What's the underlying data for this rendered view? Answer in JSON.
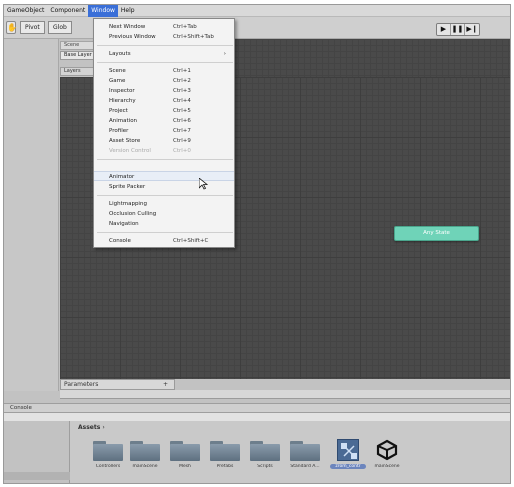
{
  "menubar": {
    "items": [
      {
        "label": "GameObject"
      },
      {
        "label": "Component"
      },
      {
        "label": "Window"
      },
      {
        "label": "Help"
      }
    ]
  },
  "toolbar": {
    "hand_icon": "✋",
    "pivot_label": "Pivot",
    "global_label": "Glob",
    "play_icons": [
      "▶",
      "❚❚",
      "▶❙"
    ]
  },
  "scene_tab": "Scene",
  "left_panel": {
    "base_layer": "Base Layer",
    "layers_label": "Layers",
    "parameters_label": "Parameters",
    "parameters_add": "+"
  },
  "canvas": {
    "any_state_label": "Any State",
    "any_state_color": "#6fd3b8"
  },
  "window_menu": {
    "items": [
      {
        "label": "Next Window",
        "shortcut": "Ctrl+Tab"
      },
      {
        "label": "Previous Window",
        "shortcut": "Ctrl+Shift+Tab"
      },
      {
        "label": "Layouts",
        "shortcut": "",
        "submenu": "›"
      },
      {
        "label": "Scene",
        "shortcut": "Ctrl+1"
      },
      {
        "label": "Game",
        "shortcut": "Ctrl+2"
      },
      {
        "label": "Inspector",
        "shortcut": "Ctrl+3"
      },
      {
        "label": "Hierarchy",
        "shortcut": "Ctrl+4"
      },
      {
        "label": "Project",
        "shortcut": "Ctrl+5"
      },
      {
        "label": "Animation",
        "shortcut": "Ctrl+6"
      },
      {
        "label": "Profiler",
        "shortcut": "Ctrl+7"
      },
      {
        "label": "Asset Store",
        "shortcut": "Ctrl+9"
      },
      {
        "label": "Version Control",
        "shortcut": "Ctrl+0"
      },
      {
        "label": "Animator",
        "shortcut": ""
      },
      {
        "label": "Sprite Packer",
        "shortcut": ""
      },
      {
        "label": "Lightmapping",
        "shortcut": ""
      },
      {
        "label": "Occlusion Culling",
        "shortcut": ""
      },
      {
        "label": "Navigation",
        "shortcut": ""
      },
      {
        "label": "Console",
        "shortcut": "Ctrl+Shift+C"
      }
    ]
  },
  "console": {
    "label": "Console"
  },
  "project": {
    "assets_label": "Assets",
    "assets_caret": "›",
    "items": [
      {
        "label": "Controllers",
        "icon": "folder-icon"
      },
      {
        "label": "mainScene",
        "icon": "folder-icon"
      },
      {
        "label": "Mesh",
        "icon": "folder-icon"
      },
      {
        "label": "Prefabs",
        "icon": "folder-icon"
      },
      {
        "label": "Scripts",
        "icon": "folder-icon"
      },
      {
        "label": "Standard A...",
        "icon": "folder-icon"
      },
      {
        "label": "zrom_contr",
        "icon": "animator-controller-icon"
      },
      {
        "label": "mainScene",
        "icon": "unity-scene-icon"
      }
    ]
  }
}
